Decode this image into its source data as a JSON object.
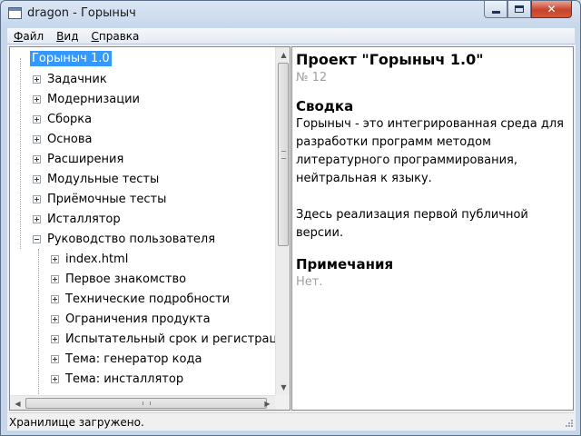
{
  "window": {
    "title": "dragon - Горыныч"
  },
  "menu": [
    {
      "first": "Ф",
      "rest": "айл"
    },
    {
      "first": "В",
      "rest": "ид"
    },
    {
      "first": "С",
      "rest": "правка"
    }
  ],
  "tree": {
    "root": "Горыныч 1.0",
    "items": [
      "Задачник",
      "Модернизации",
      "Сборка",
      "Основа",
      "Расширения",
      "Модульные тесты",
      "Приёмочные тесты",
      "Исталлятор",
      "Руководство пользователя"
    ],
    "children": [
      "index.html",
      "Первое знакомство",
      "Технические подробности",
      "Ограничения продукта",
      "Испытательный срок и регистрация",
      "Тема: генератор кода",
      "Тема: инсталлятор"
    ]
  },
  "document": {
    "title": "Проект \"Горыныч 1.0\"",
    "number": "№ 12",
    "summary_heading": "Сводка",
    "summary_p1": "Горыныч - это интегрированная среда для разработки программ методом литературного программирования, нейтральная к языку.",
    "summary_p2": "Здесь реализация первой публичной версии.",
    "notes_heading": "Примечания",
    "notes_text": "Нет."
  },
  "status": {
    "text": "Хранилище загружено."
  }
}
